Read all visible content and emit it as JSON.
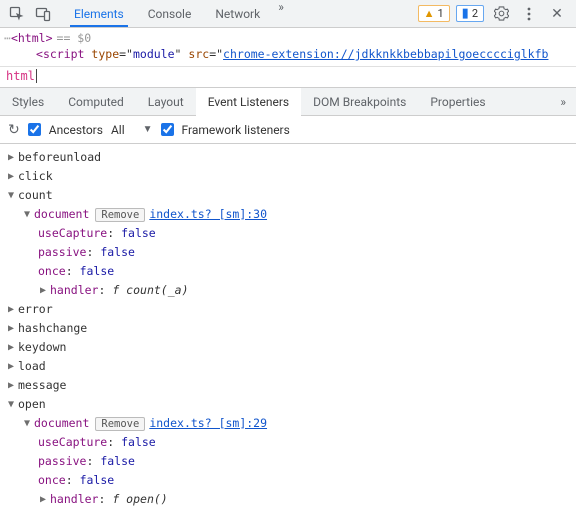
{
  "top_tabs": {
    "elements": "Elements",
    "console": "Console",
    "network": "Network"
  },
  "badges": {
    "warnings": "1",
    "messages": "2"
  },
  "source": {
    "line1_tag": "html",
    "line1_sel": "== $0",
    "line2_tag": "script",
    "line2_attr_type_n": "type",
    "line2_attr_type_v": "module",
    "line2_attr_src_n": "src",
    "line2_attr_src_v": "chrome-extension://jdkknkkbebbapilgoecccciglkfb"
  },
  "selector": "html",
  "sub_tabs": {
    "styles": "Styles",
    "computed": "Computed",
    "layout": "Layout",
    "event_listeners": "Event Listeners",
    "dom_breakpoints": "DOM Breakpoints",
    "properties": "Properties"
  },
  "toolbar": {
    "ancestors": "Ancestors",
    "filter": "All",
    "framework": "Framework listeners"
  },
  "labels": {
    "remove": "Remove",
    "document": "document",
    "useCapture": "useCapture",
    "passive": "passive",
    "once": "once",
    "handler": "handler",
    "false": "false"
  },
  "events": {
    "beforeunload": "beforeunload",
    "click": "click",
    "count": "count",
    "error": "error",
    "hashchange": "hashchange",
    "keydown": "keydown",
    "load": "load",
    "message": "message",
    "open": "open"
  },
  "listeners": {
    "count": {
      "location": "index.ts? [sm]:30",
      "handler_sig": "f count(_a)"
    },
    "open": {
      "location": "index.ts? [sm]:29",
      "handler_sig": "f open()"
    }
  }
}
